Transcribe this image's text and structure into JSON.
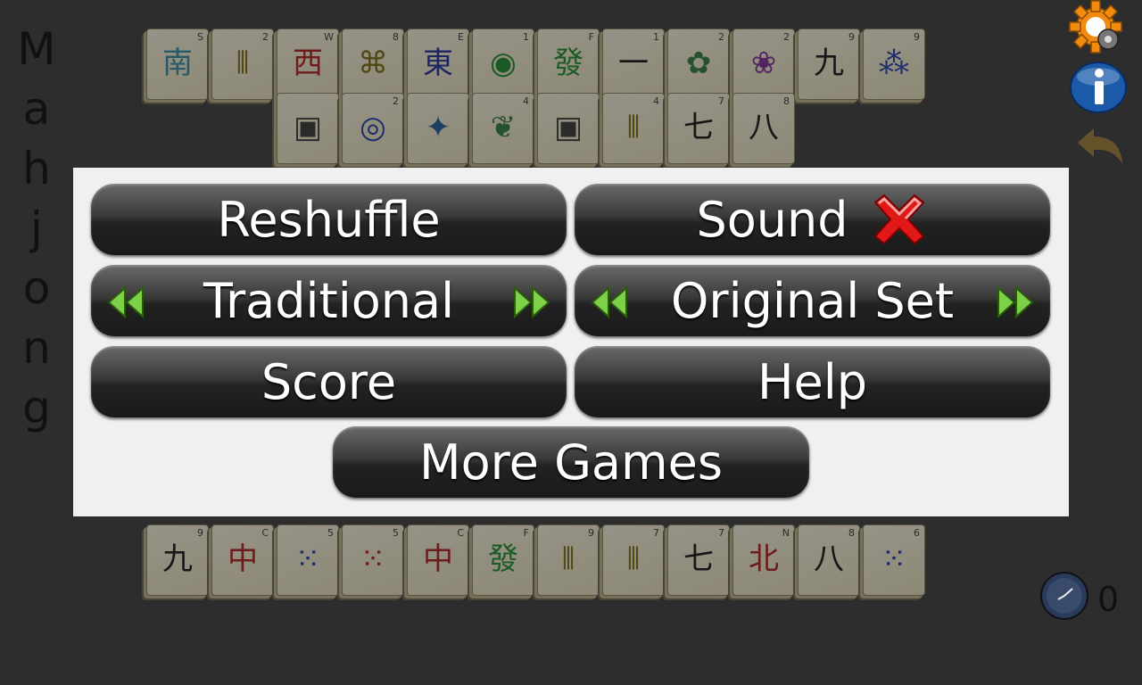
{
  "app": {
    "title_letters": [
      "M",
      "a",
      "h",
      "j",
      "o",
      "n",
      "g"
    ]
  },
  "board": {
    "top_row": [
      {
        "corner": "S",
        "glyph": "南",
        "color": "#2a8aa0"
      },
      {
        "corner": "2",
        "glyph": "⦀",
        "color": "#7a6a10"
      },
      {
        "corner": "W",
        "glyph": "西",
        "color": "#b01818"
      },
      {
        "corner": "8",
        "glyph": "⌘",
        "color": "#7a6a10"
      },
      {
        "corner": "E",
        "glyph": "東",
        "color": "#1a2a9a"
      },
      {
        "corner": "1",
        "glyph": "◉",
        "color": "#1a8a2a"
      },
      {
        "corner": "F",
        "glyph": "發",
        "color": "#1a8a2a"
      },
      {
        "corner": "1",
        "glyph": "一",
        "color": "#111"
      },
      {
        "corner": "2",
        "glyph": "✿",
        "color": "#2a7a3a"
      },
      {
        "corner": "2",
        "glyph": "❀",
        "color": "#7a2a9a"
      },
      {
        "corner": "9",
        "glyph": "九",
        "color": "#111"
      },
      {
        "corner": "9",
        "glyph": "⁂",
        "color": "#1a3aaa"
      }
    ],
    "second_row": [
      {
        "corner": "",
        "glyph": "▣",
        "color": "#333"
      },
      {
        "corner": "2",
        "glyph": "◎",
        "color": "#1a3aaa"
      },
      {
        "corner": "",
        "glyph": "✦",
        "color": "#1a5a9a"
      },
      {
        "corner": "4",
        "glyph": "❦",
        "color": "#2a7a3a"
      },
      {
        "corner": "",
        "glyph": "▣",
        "color": "#333"
      },
      {
        "corner": "4",
        "glyph": "⦀",
        "color": "#7a6a10"
      },
      {
        "corner": "7",
        "glyph": "七",
        "color": "#111"
      },
      {
        "corner": "8",
        "glyph": "八",
        "color": "#111"
      }
    ],
    "bottom_row": [
      {
        "corner": "9",
        "glyph": "九",
        "color": "#111"
      },
      {
        "corner": "C",
        "glyph": "中",
        "color": "#b01818"
      },
      {
        "corner": "5",
        "glyph": "⁙",
        "color": "#1a3aaa"
      },
      {
        "corner": "5",
        "glyph": "⁙",
        "color": "#b01818"
      },
      {
        "corner": "C",
        "glyph": "中",
        "color": "#b01818"
      },
      {
        "corner": "F",
        "glyph": "發",
        "color": "#1a8a2a"
      },
      {
        "corner": "9",
        "glyph": "⦀",
        "color": "#7a6a10"
      },
      {
        "corner": "7",
        "glyph": "⦀",
        "color": "#7a6a10"
      },
      {
        "corner": "7",
        "glyph": "七",
        "color": "#111"
      },
      {
        "corner": "N",
        "glyph": "北",
        "color": "#b01818"
      },
      {
        "corner": "8",
        "glyph": "八",
        "color": "#111"
      },
      {
        "corner": "6",
        "glyph": "⁙",
        "color": "#1a3aaa"
      }
    ]
  },
  "menu": {
    "reshuffle": "Reshuffle",
    "sound": "Sound",
    "sound_state": "off",
    "layout": "Traditional",
    "tileset": "Original Set",
    "score": "Score",
    "help": "Help",
    "more_games": "More Games"
  },
  "status": {
    "timer": "0"
  },
  "colors": {
    "dialog_bg": "#f0f0f0",
    "arrow_green": "#7ed04a",
    "sound_off": "#e01818",
    "gear": "#f08a10",
    "info": "#1a5aa8"
  }
}
